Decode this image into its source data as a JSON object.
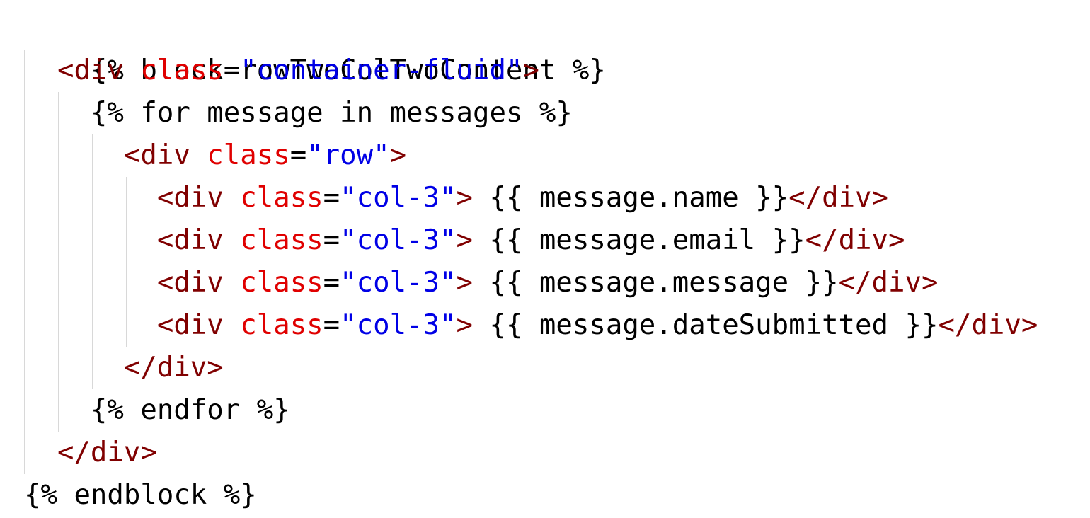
{
  "code": {
    "block_open": "{% block rowTwoColTwoContent %}",
    "for_open": "{% for message in messages %}",
    "endfor": "{% endfor %}",
    "block_close": "{% endblock %}",
    "div_open": "<div",
    "div_close": "</div>",
    "gt": ">",
    "class_attr": "class",
    "equals": "=",
    "quote": "\"",
    "container_class": "container-fluid",
    "row_class": "row",
    "col_class": "col-3",
    "expr_name": " {{ message.name }}",
    "expr_email": " {{ message.email }}",
    "expr_message": " {{ message.message }}",
    "expr_date": " {{ message.dateSubmitted }}",
    "indent_1": "  ",
    "indent_2": "    ",
    "indent_3": "      ",
    "indent_4": "        "
  },
  "colors": {
    "tag": "#800000",
    "attribute": "#e00000",
    "string": "#0000e6",
    "text": "#000000",
    "indent_guide": "#d8d8d8"
  }
}
